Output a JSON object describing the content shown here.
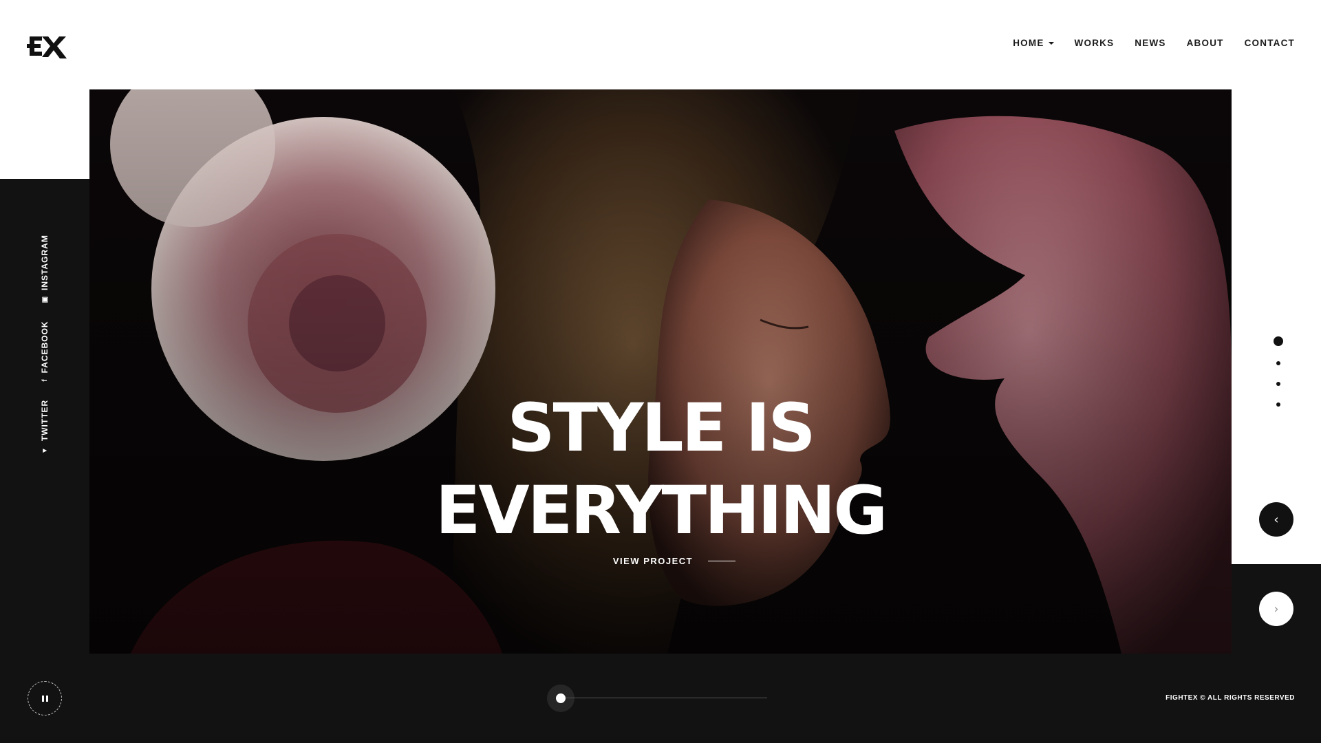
{
  "header": {
    "logo_text": "EX",
    "nav": [
      {
        "label": "HOME",
        "has_dropdown": true
      },
      {
        "label": "WORKS",
        "has_dropdown": false
      },
      {
        "label": "NEWS",
        "has_dropdown": false
      },
      {
        "label": "ABOUT",
        "has_dropdown": false
      },
      {
        "label": "CONTACT",
        "has_dropdown": false
      }
    ]
  },
  "social": [
    {
      "label": "TWITTER",
      "icon": "twitter-icon",
      "glyph": "▼"
    },
    {
      "label": "FACEBOOK",
      "icon": "facebook-icon",
      "glyph": "f"
    },
    {
      "label": "INSTAGRAM",
      "icon": "instagram-icon",
      "glyph": "▣"
    }
  ],
  "hero": {
    "title_line1": "STYLE IS",
    "title_line2": "EVERYTHING",
    "cta_label": "VIEW PROJECT"
  },
  "slider": {
    "slide_count": 4,
    "active_index": 0,
    "progress": 0.0,
    "prev_icon": "chevron-left-icon",
    "next_icon": "chevron-right-icon",
    "prev_glyph": "‹",
    "next_glyph": "›",
    "pause_icon": "pause-icon"
  },
  "footer": {
    "copyright": "FIGHTEX © ALL RIGHTS RESERVED"
  },
  "colors": {
    "dark": "#121212",
    "white": "#ffffff",
    "text": "#1a1a1a"
  }
}
